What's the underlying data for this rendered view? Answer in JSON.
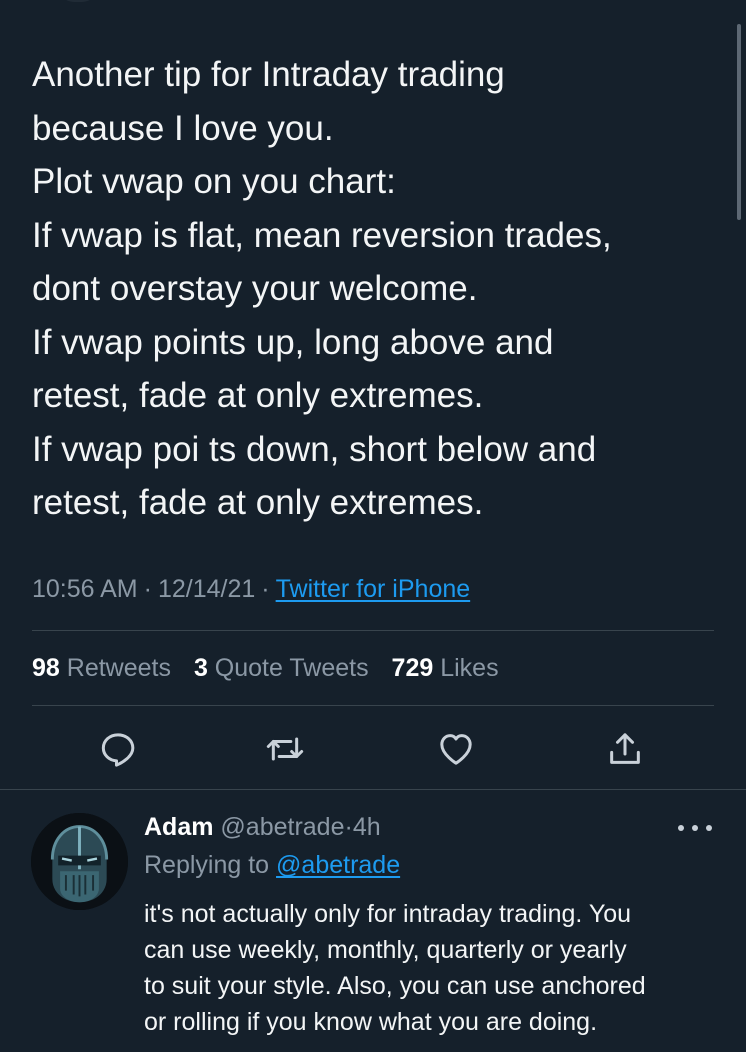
{
  "tweet": {
    "lines": [
      "Another tip for Intraday trading",
      "because I love you.",
      "Plot vwap on you chart:",
      "If vwap is flat, mean reversion trades,",
      "dont overstay your welcome.",
      "If vwap points up, long above and",
      "retest, fade at only extremes.",
      "If vwap poi ts down, short below and",
      "retest, fade at only extremes."
    ],
    "time": "10:56 AM",
    "separator": "·",
    "date": "12/14/21",
    "source": "Twitter for iPhone"
  },
  "stats": {
    "retweets_count": "98",
    "retweets_label": "Retweets",
    "quotes_count": "3",
    "quotes_label": "Quote Tweets",
    "likes_count": "729",
    "likes_label": "Likes"
  },
  "actions": {
    "icons": [
      "reply-icon",
      "retweet-icon",
      "like-icon",
      "share-icon"
    ]
  },
  "reply": {
    "name": "Adam",
    "handle": "@abetrade",
    "separator": "·",
    "age": "4h",
    "replying_prefix": "Replying to",
    "replying_handle": "@abetrade",
    "lines": [
      "it's not actually only for intraday trading. You",
      "can use weekly, monthly, quarterly or yearly",
      "to suit your style. Also, you can use anchored",
      "or rolling if you know what you are doing."
    ]
  },
  "colors": {
    "background": "#15202b",
    "text": "#f3f5f6",
    "secondary_text": "#8b98a5",
    "link": "#1d9bf0",
    "divider": "#38444d"
  }
}
